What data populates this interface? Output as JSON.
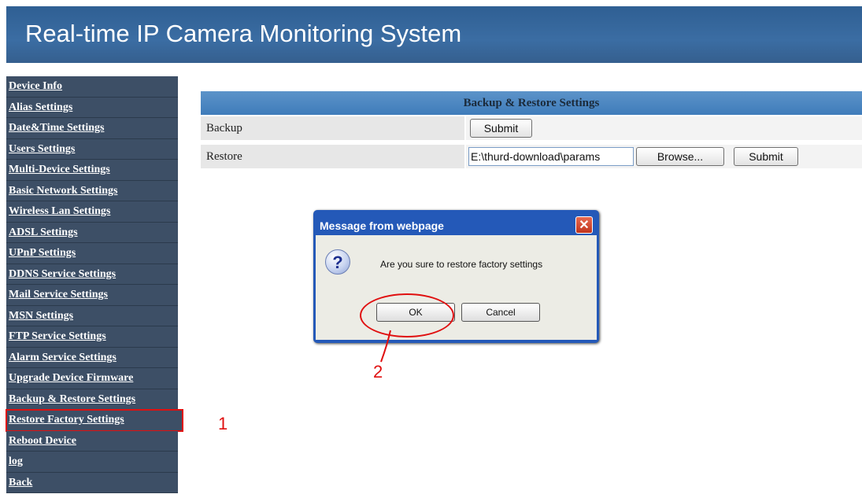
{
  "header": {
    "title": "Real-time IP Camera Monitoring System"
  },
  "sidebar": {
    "items": [
      {
        "label": "Device Info"
      },
      {
        "label": "Alias Settings"
      },
      {
        "label": "Date&Time Settings"
      },
      {
        "label": "Users Settings"
      },
      {
        "label": "Multi-Device Settings"
      },
      {
        "label": "Basic Network Settings"
      },
      {
        "label": "Wireless Lan Settings"
      },
      {
        "label": "ADSL Settings"
      },
      {
        "label": "UPnP Settings"
      },
      {
        "label": "DDNS Service Settings"
      },
      {
        "label": "Mail Service Settings"
      },
      {
        "label": "MSN Settings"
      },
      {
        "label": "FTP Service Settings"
      },
      {
        "label": "Alarm Service Settings"
      },
      {
        "label": "Upgrade Device Firmware"
      },
      {
        "label": "Backup & Restore Settings"
      },
      {
        "label": "Restore Factory Settings"
      },
      {
        "label": "Reboot Device"
      },
      {
        "label": "log"
      },
      {
        "label": "Back"
      }
    ]
  },
  "panel": {
    "title": "Backup & Restore Settings",
    "backup": {
      "label": "Backup",
      "submit_label": "Submit"
    },
    "restore": {
      "label": "Restore",
      "file_value": "E:\\thurd-download\\params",
      "browse_label": "Browse...",
      "submit_label": "Submit"
    }
  },
  "dialog": {
    "title": "Message from webpage",
    "close_glyph": "✕",
    "icon_glyph": "?",
    "message": "Are you sure to restore factory settings",
    "ok_label": "OK",
    "cancel_label": "Cancel"
  },
  "annotations": {
    "step1": "1",
    "step2": "2"
  },
  "colors": {
    "header_bg": "#3b6da3",
    "sidebar_bg": "#3d4f66",
    "highlight": "#e01010",
    "dialog_frame": "#2459b8"
  }
}
